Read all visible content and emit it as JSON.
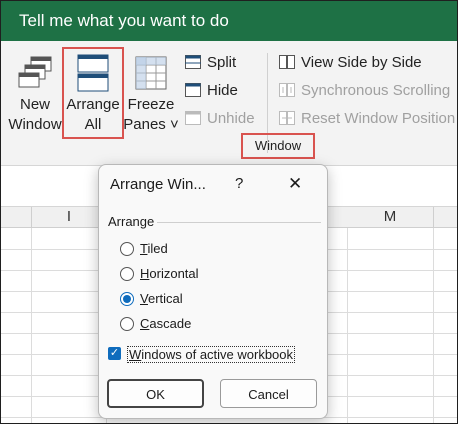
{
  "titlebar": {
    "text": "Tell me what you want to do"
  },
  "ribbon": {
    "new_window": [
      "New",
      "Window"
    ],
    "arrange_all": [
      "Arrange",
      "All"
    ],
    "freeze_panes": [
      "Freeze",
      "Panes ˅"
    ],
    "split": "Split",
    "hide": "Hide",
    "unhide": "Unhide",
    "view_side_by_side": "View Side by Side",
    "synchronous_scrolling": "Synchronous Scrolling",
    "reset_window_position": "Reset Window Position",
    "group_label": "Window"
  },
  "sheet": {
    "columns": [
      "I",
      "M"
    ]
  },
  "dialog": {
    "title": "Arrange Win...",
    "help": "?",
    "close": "✕",
    "group_title": "Arrange",
    "options": [
      {
        "first": "T",
        "rest": "iled",
        "checked": false
      },
      {
        "first": "H",
        "rest": "orizontal",
        "checked": false
      },
      {
        "first": "V",
        "rest": "ertical",
        "checked": true
      },
      {
        "first": "C",
        "rest": "ascade",
        "checked": false
      }
    ],
    "checkbox": {
      "first": "W",
      "rest": "indows of active workbook",
      "checked": true
    },
    "ok": "OK",
    "cancel": "Cancel"
  },
  "colors": {
    "titlebar": "#1e7145",
    "highlight": "#d9534f",
    "accent": "#0f6cbd"
  }
}
